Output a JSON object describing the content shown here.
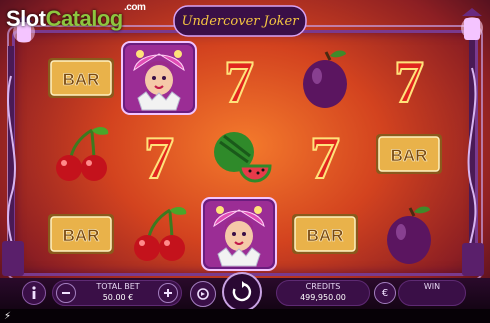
{
  "watermark": {
    "slot": "Slot",
    "catalog": "Catalog",
    "com": ".com"
  },
  "game_title": "Undercover Joker",
  "reels": [
    [
      "bar",
      "joker",
      "bar"
    ],
    [
      "cherry",
      "joker",
      "cherry"
    ],
    [
      "seven",
      "watermelon",
      "joker"
    ],
    [
      "plum",
      "watermelon",
      "bar"
    ],
    [
      "seven",
      "seven",
      "plum"
    ],
    [
      "seven",
      "bar",
      "plum"
    ]
  ],
  "symbol_text": {
    "bar": "BAR",
    "seven": "7"
  },
  "hud": {
    "info_icon": "info-icon",
    "minus_icon": "minus-icon",
    "plus_icon": "plus-icon",
    "total_bet_label": "TOTAL BET",
    "total_bet_value": "50.00 €",
    "autoplay_icon": "autoplay-icon",
    "spin_icon": "spin-icon",
    "credits_label": "CREDITS",
    "credits_value": "499,950.00",
    "currency_symbol": "€",
    "win_label": "WIN",
    "win_value": ""
  },
  "colors": {
    "accent_purple": "#7a3a8e",
    "hud_panel": "#3a0f47",
    "bar_gold": "#e9b24a",
    "seven_red": "#e0241f",
    "cherry_red": "#c4121c",
    "plum_purple": "#5b1560",
    "brand_green": "#8dc63f"
  }
}
